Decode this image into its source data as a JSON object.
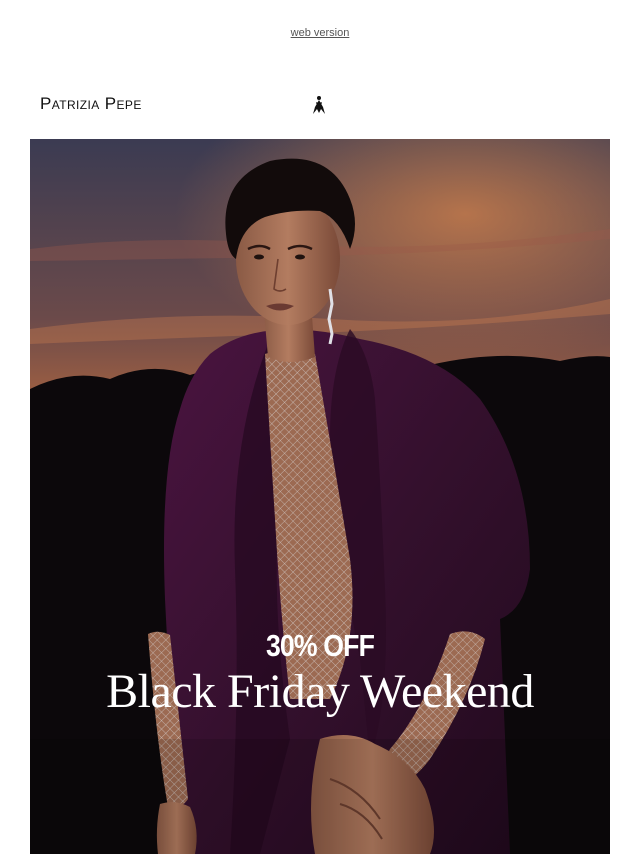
{
  "preheader": {
    "web_version_link": "web version"
  },
  "header": {
    "brand_name": "Patrizia Pepe",
    "brand_icon": "fly-logo-icon"
  },
  "hero": {
    "image_description_icon": "model-in-purple-coat-photo",
    "discount": "30% OFF",
    "headline": "Black Friday Weekend"
  },
  "colors": {
    "background": "#ffffff",
    "coat": "#3a0f2e",
    "sky_orange": "#c7713b",
    "text_on_image": "#ffffff"
  }
}
